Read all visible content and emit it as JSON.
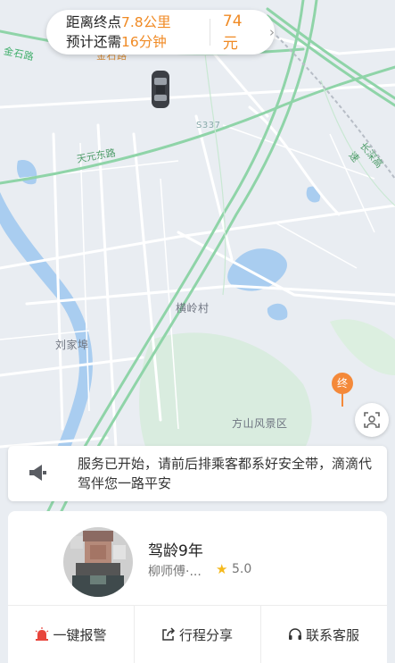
{
  "trip": {
    "distance_prefix": "距离终点",
    "distance_value": "7.8公里",
    "time_prefix": "预计还需",
    "time_value": "16分钟",
    "fare": "74元",
    "chevron_icon": "chevron-right-icon"
  },
  "map": {
    "labels": {
      "jinshi_road": "金石路",
      "jinshi_road_2": "金石路",
      "tianyuan_east_road": "天元东路",
      "changshen_expressway": "长深高速",
      "hengling_village": "横岭村",
      "liujiawei": "刘家埠",
      "fangshan_scenic": "方山风景区",
      "road_sign": "S337"
    },
    "destination_marker": "终",
    "locate_icon": "locate-me-icon"
  },
  "notice": {
    "icon": "megaphone-icon",
    "text": "服务已开始，请前后排乘客都系好安全带，滴滴代驾伴您一路平安"
  },
  "driver": {
    "avatar_icon": "avatar",
    "driving_years": "驾龄9年",
    "name": "柳师傅·...",
    "rating": "5.0",
    "star_icon": "star-icon"
  },
  "actions": {
    "alarm_label": "一键报警",
    "share_label": "行程分享",
    "service_label": "联系客服"
  },
  "colors": {
    "accent_orange": "#f08a24",
    "map_background": "#e9edf2",
    "road_green": "#8fd4a8",
    "water_blue": "#a9cdf0",
    "alarm_red": "#e8453c"
  }
}
